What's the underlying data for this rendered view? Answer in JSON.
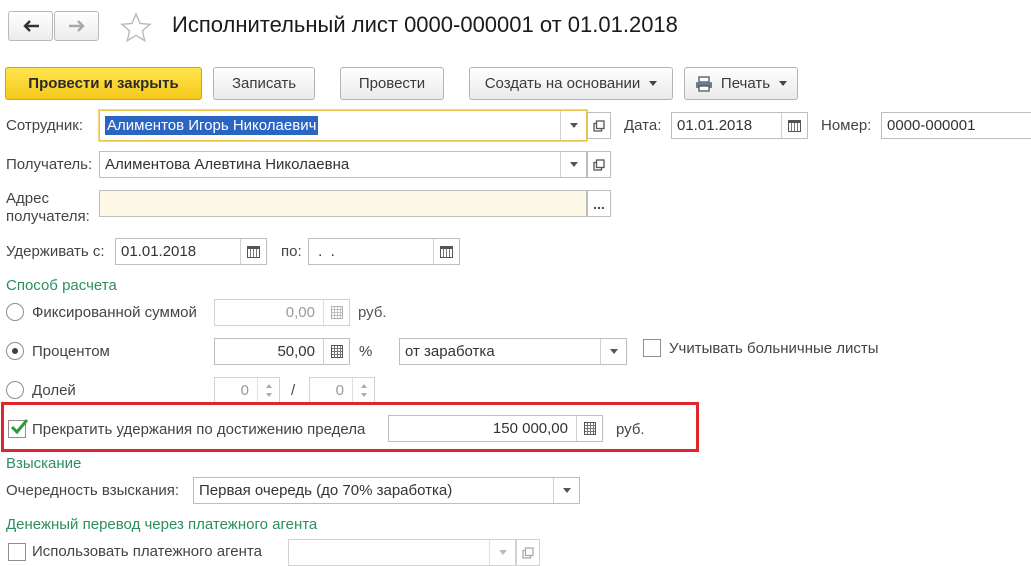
{
  "header": {
    "title": "Исполнительный лист 0000-000001 от 01.01.2018",
    "back_icon": "arrow-left",
    "forward_icon": "arrow-right",
    "favorite_icon": "star"
  },
  "toolbar": {
    "post_close": "Провести и закрыть",
    "save": "Записать",
    "post": "Провести",
    "create_based": "Создать на основании",
    "print": "Печать"
  },
  "form": {
    "employee_label": "Сотрудник:",
    "employee_value": "Алиментов Игорь Николаевич",
    "date_label": "Дата:",
    "date_value": "01.01.2018",
    "number_label": "Номер:",
    "number_value": "0000-000001",
    "recipient_label": "Получатель:",
    "recipient_value": "Алиментова Алевтина Николаевна",
    "address_label_1": "Адрес",
    "address_label_2": "получателя:",
    "address_value": "",
    "address_button": "...",
    "withhold_from_label": "Удерживать с:",
    "withhold_from_value": "01.01.2018",
    "withhold_to_label": "по:",
    "withhold_to_value": " .  ."
  },
  "calculation": {
    "section_title": "Способ расчета",
    "fixed_label": "Фиксированной суммой",
    "fixed_value": "0,00",
    "fixed_unit": "руб.",
    "percent_label": "Процентом",
    "percent_value": "50,00",
    "percent_unit": "%",
    "percent_base": "от заработка",
    "sick_leave_label": "Учитывать больничные листы",
    "shares_label": "Долей",
    "shares_num": "0",
    "shares_sep": "/",
    "shares_den": "0",
    "selected_method": "Процентом",
    "limit_label": "Прекратить удержания по достижению предела",
    "limit_value": "150 000,00",
    "limit_unit": "руб.",
    "limit_checked": true
  },
  "collection": {
    "section_title": "Взыскание",
    "order_label": "Очередность взыскания:",
    "order_value": "Первая очередь (до 70% заработка)"
  },
  "transfer": {
    "section_title": "Денежный перевод через платежного агента",
    "use_agent_label": "Использовать платежного агента"
  },
  "colors": {
    "primary_button": "#f5c91a",
    "section_green": "#2b8f5e",
    "highlight_red": "#e0262b",
    "selection_blue": "#2b65c4",
    "address_bg": "#fdf8e6"
  }
}
